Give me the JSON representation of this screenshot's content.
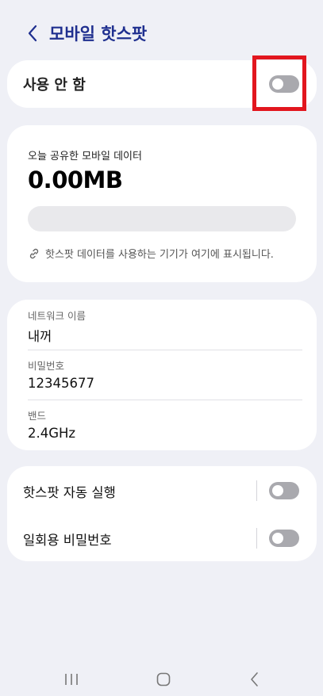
{
  "header": {
    "title": "모바일 핫스팟"
  },
  "master": {
    "label": "사용 안 함",
    "enabled": false
  },
  "data_usage": {
    "label": "오늘 공유한 모바일 데이터",
    "value": "0.00MB",
    "usage_fraction": 0,
    "note": "핫스팟 데이터를 사용하는 기기가 여기에 표시됩니다."
  },
  "network": {
    "name_label": "네트워크 이름",
    "name_value": "내꺼",
    "password_label": "비밀번호",
    "password_value": "12345677",
    "band_label": "밴드",
    "band_value": "2.4GHz"
  },
  "toggles": [
    {
      "label": "핫스팟 자동 실행",
      "enabled": false
    },
    {
      "label": "일회용 비밀번호",
      "enabled": false
    }
  ],
  "colors": {
    "accent": "#1f2f8f",
    "highlight": "#e2161e",
    "toggle_off": "#a9a9ae",
    "background": "#eff0f6"
  },
  "icons": {
    "back": "chevron-left-icon",
    "link": "link-icon",
    "nav_recents": "recents-icon",
    "nav_home": "home-icon",
    "nav_back": "back-icon"
  }
}
